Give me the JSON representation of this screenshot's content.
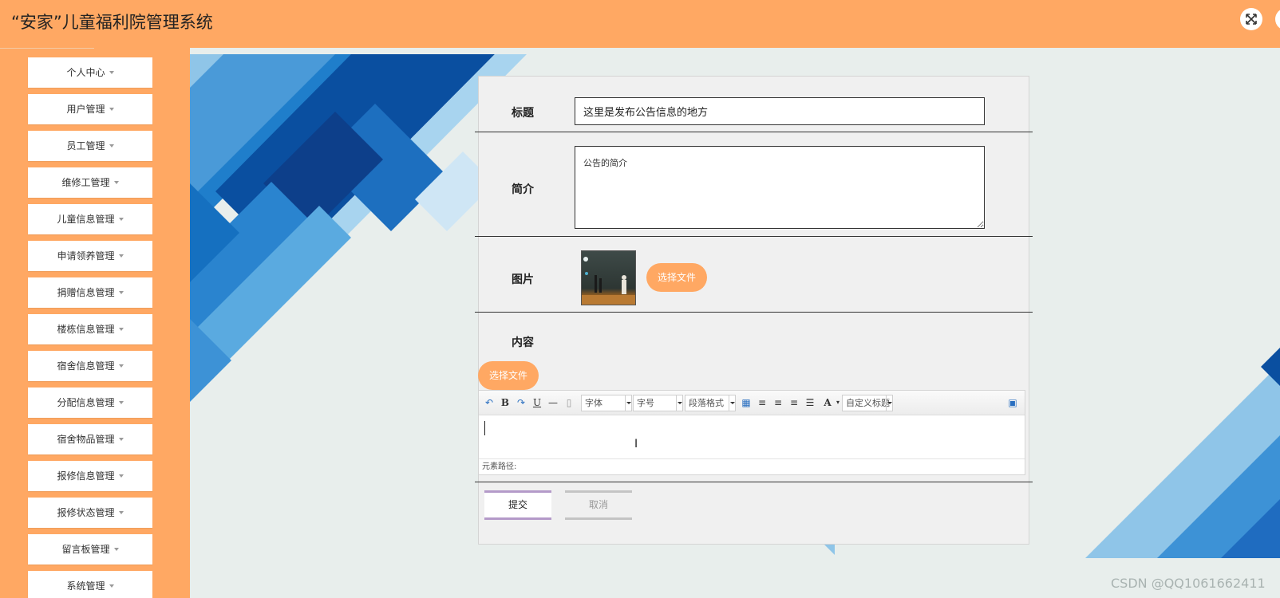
{
  "header": {
    "title": "“安家”儿童福利院管理系统"
  },
  "sidebar": {
    "items": [
      {
        "label": "个人中心"
      },
      {
        "label": "用户管理"
      },
      {
        "label": "员工管理"
      },
      {
        "label": "维修工管理"
      },
      {
        "label": "儿童信息管理"
      },
      {
        "label": "申请领养管理"
      },
      {
        "label": "捐赠信息管理"
      },
      {
        "label": "楼栋信息管理"
      },
      {
        "label": "宿舍信息管理"
      },
      {
        "label": "分配信息管理"
      },
      {
        "label": "宿舍物品管理"
      },
      {
        "label": "报修信息管理"
      },
      {
        "label": "报修状态管理"
      },
      {
        "label": "留言板管理"
      },
      {
        "label": "系统管理"
      }
    ]
  },
  "form": {
    "title_label": "标题",
    "title_value": "这里是发布公告信息的地方",
    "summary_label": "简介",
    "summary_value": "公告的简介",
    "image_label": "图片",
    "image_upload_label": "选择文件",
    "content_label": "内容",
    "content_upload_label": "选择文件",
    "submit_label": "提交",
    "cancel_label": "取消"
  },
  "editor": {
    "font_family": "字体",
    "font_size": "字号",
    "paragraph": "段落格式",
    "custom_title": "自定义标题",
    "path_label": "元素路径:",
    "icons": [
      "undo-icon",
      "bold-icon",
      "redo-icon",
      "underline-icon",
      "horizontal-rule-icon",
      "paste-icon",
      "table-icon",
      "align-left-icon",
      "align-right-icon",
      "align-center-icon",
      "justify-icon",
      "font-color-icon",
      "preview-icon"
    ]
  },
  "watermark": "CSDN @QQ1061662411",
  "colors": {
    "accent": "#ffa863",
    "submit_border": "#b49ac9",
    "background": "#e8eeec"
  }
}
